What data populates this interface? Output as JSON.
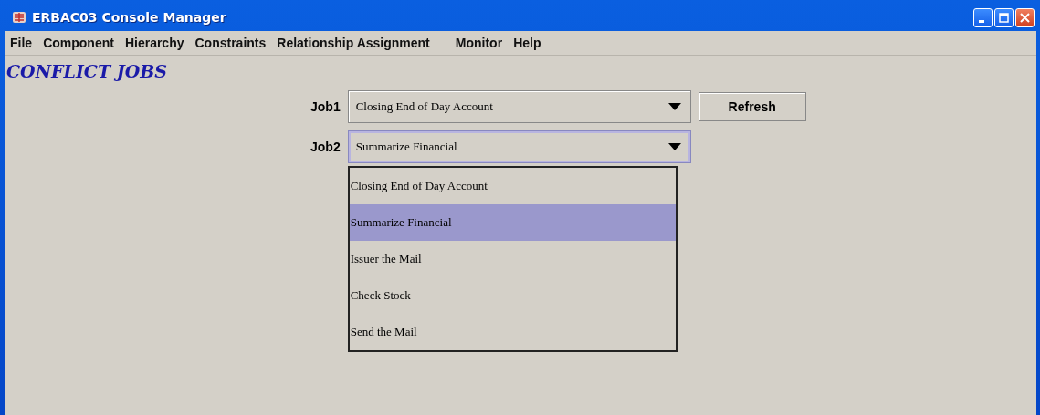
{
  "window": {
    "title": "ERBAC03 Console Manager"
  },
  "menu": [
    "File",
    "Component",
    "Hierarchy",
    "Constraints",
    "Relationship Assignment",
    "Monitor",
    "Help"
  ],
  "heading": "CONFLICT JOBS",
  "job1": {
    "label": "Job1",
    "value": "Closing End of Day Account",
    "focused": false
  },
  "job2": {
    "label": "Job2",
    "value": "Summarize Financial",
    "focused": true,
    "options": [
      {
        "label": "Closing End of Day Account",
        "selected": false
      },
      {
        "label": "Summarize Financial",
        "selected": true
      },
      {
        "label": "Issuer the Mail",
        "selected": false
      },
      {
        "label": "Check Stock",
        "selected": false
      },
      {
        "label": "Send the Mail",
        "selected": false
      }
    ]
  },
  "refresh_button": "Refresh"
}
